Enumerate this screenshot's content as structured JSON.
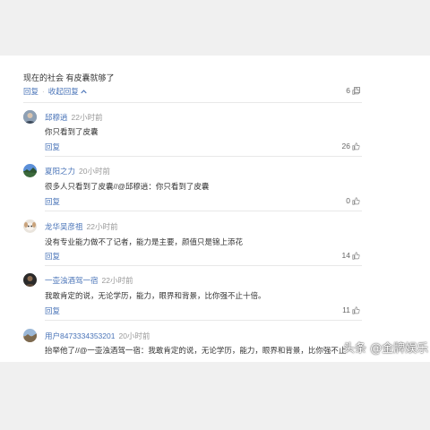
{
  "top_comment": {
    "text": "现在的社会 有皮囊就够了",
    "reply_label": "回复",
    "collapse_label": "收起回复",
    "likes": "6"
  },
  "replies": [
    {
      "username": "邱穆逍",
      "time": "22小时前",
      "text": "你只看到了皮囊",
      "reply_label": "回复",
      "likes": "26"
    },
    {
      "username": "夏阳之力",
      "time": "20小时前",
      "text": "很多人只看到了皮囊//@邱穆逍：你只看到了皮囊",
      "reply_label": "回复",
      "likes": "0"
    },
    {
      "username": "龙华吴彦祖",
      "time": "22小时前",
      "text": "没有专业能力做不了记者，能力是主要，颜值只是锦上添花",
      "reply_label": "回复",
      "likes": "14"
    },
    {
      "username": "一壶浊酒驾一宿",
      "time": "22小时前",
      "text": "我敢肯定的说，无论学历，能力，眼界和背景，比你强不止十倍。",
      "reply_label": "回复",
      "likes": "11"
    },
    {
      "username": "用户8473334353201",
      "time": "20小时前",
      "text": "抬举他了//@一壶浊酒驾一宿：我敢肯定的说，无论学历，能力，眼界和背景，比你强不止",
      "reply_label": "",
      "likes": ""
    }
  ],
  "watermark": "头条 @金牌娱乐",
  "colors": {
    "link": "#4a74b8",
    "text": "#333333",
    "muted": "#999999",
    "background": "#f0f0f0"
  }
}
